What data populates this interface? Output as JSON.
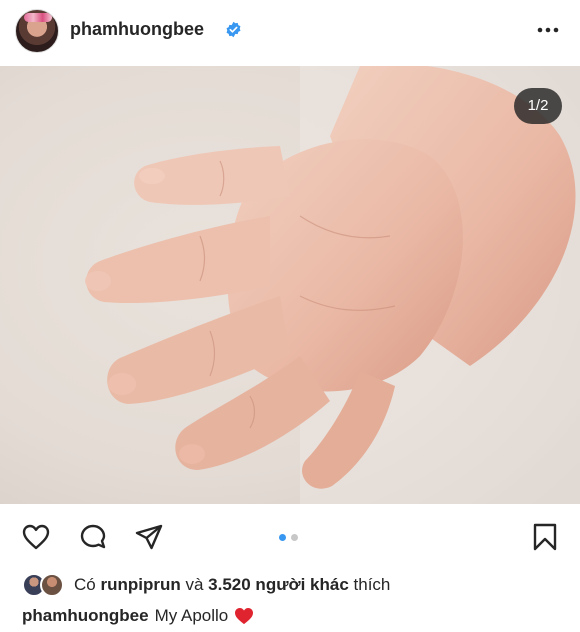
{
  "post": {
    "username": "phamhuongbee",
    "media_counter": "1/2",
    "carousel": {
      "total": 2,
      "current": 1
    },
    "likes": {
      "prefix": "Có",
      "first_user": "runpiprun",
      "conjunction": "và",
      "others_count": "3.520 người khác",
      "suffix": "thích"
    },
    "caption": {
      "username": "phamhuongbee",
      "text": "My Apollo",
      "emoji": "red-heart"
    }
  },
  "icons": {
    "verified": "verified-badge-icon",
    "more": "more-options-icon",
    "like": "heart-outline-icon",
    "comment": "comment-bubble-icon",
    "share": "paper-plane-icon",
    "save": "bookmark-icon"
  },
  "colors": {
    "verified_blue": "#3897f0",
    "active_dot": "#3897f0",
    "text": "#262626"
  }
}
